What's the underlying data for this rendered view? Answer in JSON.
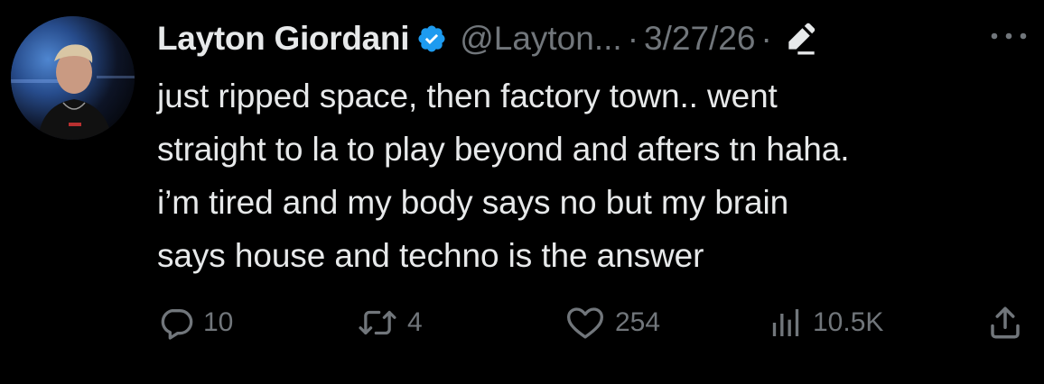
{
  "tweet": {
    "author": {
      "name": "Layton Giordani",
      "handle": "@Layton...",
      "verified": true,
      "avatar_icon": "profile-photo"
    },
    "separator": "·",
    "date": "3/27/26",
    "edited_icon": "pencil-edit-icon",
    "more_icon": "more-dots-icon",
    "text_lines": [
      "just ripped space, then factory town.. went",
      "straight to la to play beyond and afters tn haha.",
      "i’m tired and my body says no but my brain",
      "says house and techno is the answer"
    ],
    "actions": {
      "replies": "10",
      "reposts": "4",
      "likes": "254",
      "views": "10.5K"
    }
  },
  "colors": {
    "background": "#000000",
    "text_primary": "#e7e9ea",
    "text_secondary": "#71767b",
    "verified_blue": "#1d9bf0"
  }
}
